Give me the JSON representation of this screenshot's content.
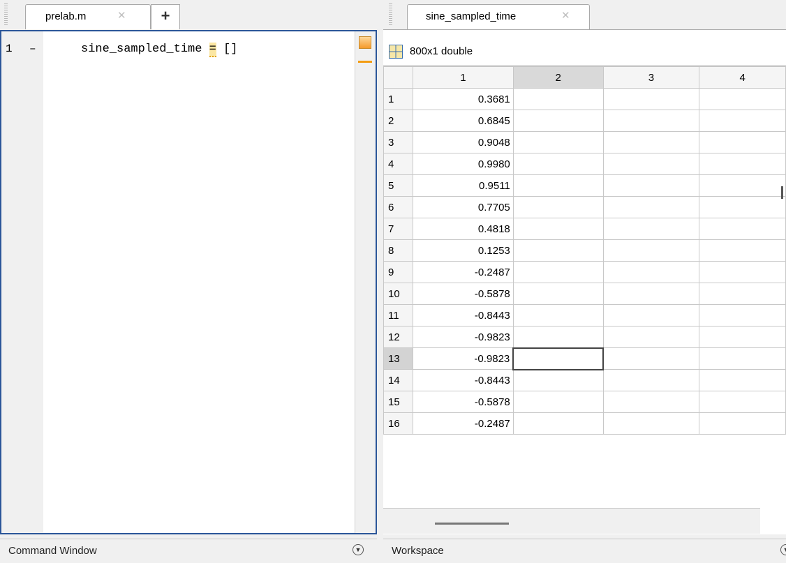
{
  "editor": {
    "tab_label": "prelab.m",
    "tab_close": "✕",
    "new_tab": "+",
    "line_number": "1",
    "line_marker": "–",
    "code": {
      "before": "sine_sampled_time ",
      "warn_token": "=",
      "after": " []"
    }
  },
  "variable_editor": {
    "tab_label": "sine_sampled_time",
    "tab_close": "✕",
    "size_label": "800x1 double",
    "columns": [
      "1",
      "2",
      "3",
      "4"
    ],
    "selected_column": "2",
    "rows": [
      {
        "index": "1",
        "value": "0.3681"
      },
      {
        "index": "2",
        "value": "0.6845"
      },
      {
        "index": "3",
        "value": "0.9048"
      },
      {
        "index": "4",
        "value": "0.9980"
      },
      {
        "index": "5",
        "value": "0.9511"
      },
      {
        "index": "6",
        "value": "0.7705"
      },
      {
        "index": "7",
        "value": "0.4818"
      },
      {
        "index": "8",
        "value": "0.1253"
      },
      {
        "index": "9",
        "value": "-0.2487"
      },
      {
        "index": "10",
        "value": "-0.5878"
      },
      {
        "index": "11",
        "value": "-0.8443"
      },
      {
        "index": "12",
        "value": "-0.9823"
      },
      {
        "index": "13",
        "value": "-0.9823"
      },
      {
        "index": "14",
        "value": "-0.8443"
      },
      {
        "index": "15",
        "value": "-0.5878"
      },
      {
        "index": "16",
        "value": "-0.2487"
      }
    ],
    "selected_row": "13"
  },
  "bottom": {
    "command_window": "Command Window",
    "workspace": "Workspace",
    "menu_icon": "▼"
  },
  "colors": {
    "focus_border": "#2b5699",
    "warning": "#f39c12"
  }
}
